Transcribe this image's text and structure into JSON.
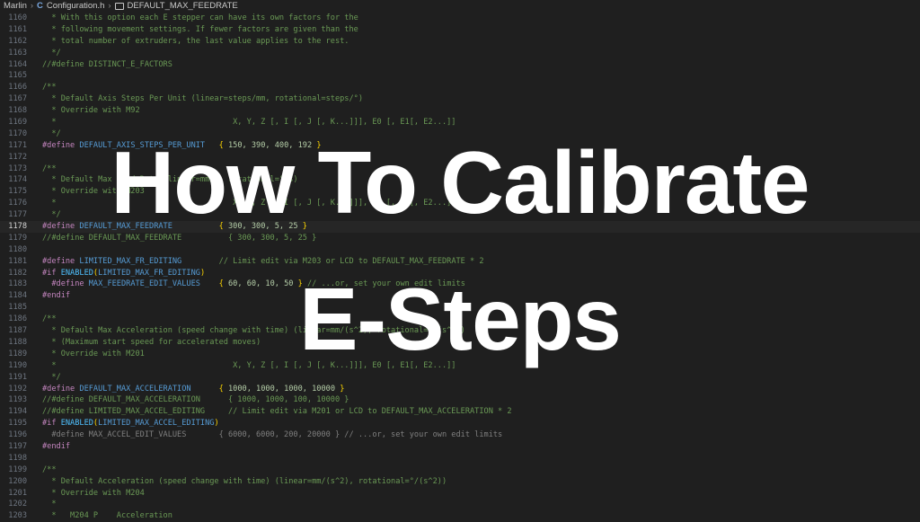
{
  "breadcrumb": {
    "items": [
      "Marlin",
      "Configuration.h",
      "DEFAULT_MAX_FEEDRATE"
    ],
    "file_icon": "c-language-icon",
    "symbol_icon": "symbol-constant-icon"
  },
  "editor": {
    "active_line": "1178",
    "lines": [
      {
        "n": "1160",
        "t": [
          [
            "cm",
            "  * With this option each E stepper can have its own factors for the"
          ]
        ]
      },
      {
        "n": "1161",
        "t": [
          [
            "cm",
            "  * following movement settings. If fewer factors are given than the"
          ]
        ]
      },
      {
        "n": "1162",
        "t": [
          [
            "cm",
            "  * total number of extruders, the last value applies to the rest."
          ]
        ]
      },
      {
        "n": "1163",
        "t": [
          [
            "cm",
            "  */"
          ]
        ]
      },
      {
        "n": "1164",
        "t": [
          [
            "cm",
            "//#define DISTINCT_E_FACTORS"
          ]
        ]
      },
      {
        "n": "1165",
        "t": []
      },
      {
        "n": "1166",
        "t": [
          [
            "cm",
            "/**"
          ]
        ]
      },
      {
        "n": "1167",
        "t": [
          [
            "cm",
            "  * Default Axis Steps Per Unit (linear=steps/mm, rotational=steps/°)"
          ]
        ]
      },
      {
        "n": "1168",
        "t": [
          [
            "cm",
            "  * Override with M92"
          ]
        ]
      },
      {
        "n": "1169",
        "t": [
          [
            "cm",
            "  *                                      X, Y, Z [, I [, J [, K...]]], E0 [, E1[, E2...]]"
          ]
        ]
      },
      {
        "n": "1170",
        "t": [
          [
            "cm",
            "  */"
          ]
        ]
      },
      {
        "n": "1171",
        "t": [
          [
            "kw",
            "#define "
          ],
          [
            "mac",
            "DEFAULT_AXIS_STEPS_PER_UNIT"
          ],
          [
            "",
            "   "
          ],
          [
            "br",
            "{"
          ],
          [
            "num",
            " 150, 390, 400, 192 "
          ],
          [
            "br",
            "}"
          ]
        ]
      },
      {
        "n": "1172",
        "t": []
      },
      {
        "n": "1173",
        "t": [
          [
            "cm",
            "/**"
          ]
        ]
      },
      {
        "n": "1174",
        "t": [
          [
            "cm",
            "  * Default Max Feed Rate (linear=mm/s, rotational=°/s)"
          ]
        ]
      },
      {
        "n": "1175",
        "t": [
          [
            "cm",
            "  * Override with M203"
          ]
        ]
      },
      {
        "n": "1176",
        "t": [
          [
            "cm",
            "  *                                      X, Y, Z [, I [, J [, K...]]], E0 [, E1[, E2...]]"
          ]
        ]
      },
      {
        "n": "1177",
        "t": [
          [
            "cm",
            "  */"
          ]
        ]
      },
      {
        "n": "1178",
        "t": [
          [
            "kw",
            "#define "
          ],
          [
            "mac",
            "DEFAULT_MAX_FEEDRATE"
          ],
          [
            "",
            "          "
          ],
          [
            "br",
            "{"
          ],
          [
            "num",
            " 300, 300, 5, 25 "
          ],
          [
            "br",
            "}"
          ]
        ]
      },
      {
        "n": "1179",
        "t": [
          [
            "cm",
            "//#define DEFAULT_MAX_FEEDRATE          { 300, 300, 5, 25 }"
          ]
        ]
      },
      {
        "n": "1180",
        "t": []
      },
      {
        "n": "1181",
        "t": [
          [
            "kw",
            "#define "
          ],
          [
            "mac",
            "LIMITED_MAX_FR_EDITING"
          ],
          [
            "",
            "        "
          ],
          [
            "cm",
            "// Limit edit via M203 or LCD to DEFAULT_MAX_FEEDRATE * 2"
          ]
        ]
      },
      {
        "n": "1182",
        "t": [
          [
            "kw",
            "#if "
          ],
          [
            "fn",
            "ENABLED"
          ],
          [
            "br",
            "("
          ],
          [
            "mac",
            "LIMITED_MAX_FR_EDITING"
          ],
          [
            "br",
            ")"
          ]
        ]
      },
      {
        "n": "1183",
        "t": [
          [
            "kw",
            "  #define "
          ],
          [
            "mac",
            "MAX_FEEDRATE_EDIT_VALUES"
          ],
          [
            "",
            "    "
          ],
          [
            "br",
            "{"
          ],
          [
            "num",
            " 60, 60, 10, 50 "
          ],
          [
            "br",
            "}"
          ],
          [
            "cm",
            " // ...or, set your own edit limits"
          ]
        ]
      },
      {
        "n": "1184",
        "t": [
          [
            "kw",
            "#endif"
          ]
        ]
      },
      {
        "n": "1185",
        "t": []
      },
      {
        "n": "1186",
        "t": [
          [
            "cm",
            "/**"
          ]
        ]
      },
      {
        "n": "1187",
        "t": [
          [
            "cm",
            "  * Default Max Acceleration (speed change with time) (linear=mm/(s^2), rotational=°/(s^2))"
          ]
        ]
      },
      {
        "n": "1188",
        "t": [
          [
            "cm",
            "  * (Maximum start speed for accelerated moves)"
          ]
        ]
      },
      {
        "n": "1189",
        "t": [
          [
            "cm",
            "  * Override with M201"
          ]
        ]
      },
      {
        "n": "1190",
        "t": [
          [
            "cm",
            "  *                                      X, Y, Z [, I [, J [, K...]]], E0 [, E1[, E2...]]"
          ]
        ]
      },
      {
        "n": "1191",
        "t": [
          [
            "cm",
            "  */"
          ]
        ]
      },
      {
        "n": "1192",
        "t": [
          [
            "kw",
            "#define "
          ],
          [
            "mac",
            "DEFAULT_MAX_ACCELERATION"
          ],
          [
            "",
            "      "
          ],
          [
            "br",
            "{"
          ],
          [
            "num",
            " 1000, 1000, 1000, 10000 "
          ],
          [
            "br",
            "}"
          ]
        ]
      },
      {
        "n": "1193",
        "t": [
          [
            "cm",
            "//#define DEFAULT_MAX_ACCELERATION      { 1000, 1000, 100, 10000 }"
          ]
        ]
      },
      {
        "n": "1194",
        "t": [
          [
            "cm",
            "//#define LIMITED_MAX_ACCEL_EDITING     // Limit edit via M201 or LCD to DEFAULT_MAX_ACCELERATION * 2"
          ]
        ]
      },
      {
        "n": "1195",
        "t": [
          [
            "kw",
            "#if "
          ],
          [
            "fn",
            "ENABLED"
          ],
          [
            "br",
            "("
          ],
          [
            "mac",
            "LIMITED_MAX_ACCEL_EDITING"
          ],
          [
            "br",
            ")"
          ]
        ]
      },
      {
        "n": "1196",
        "t": [
          [
            "dim",
            "  #define MAX_ACCEL_EDIT_VALUES       { 6000, 6000, 200, 20000 } // ...or, set your own edit limits"
          ]
        ]
      },
      {
        "n": "1197",
        "t": [
          [
            "kw",
            "#endif"
          ]
        ]
      },
      {
        "n": "1198",
        "t": []
      },
      {
        "n": "1199",
        "t": [
          [
            "cm",
            "/**"
          ]
        ]
      },
      {
        "n": "1200",
        "t": [
          [
            "cm",
            "  * Default Acceleration (speed change with time) (linear=mm/(s^2), rotational=°/(s^2))"
          ]
        ]
      },
      {
        "n": "1201",
        "t": [
          [
            "cm",
            "  * Override with M204"
          ]
        ]
      },
      {
        "n": "1202",
        "t": [
          [
            "cm",
            "  *"
          ]
        ]
      },
      {
        "n": "1203",
        "t": [
          [
            "cm",
            "  *   M204 P    Acceleration"
          ]
        ]
      }
    ]
  },
  "overlay": {
    "title_line1": "How To Calibrate",
    "title_line2": "E-Steps"
  },
  "colors": {
    "background": "#1f1f1f",
    "comment": "#6a9955",
    "keyword": "#c586c0",
    "macro": "#569cd6",
    "number": "#b5cea8",
    "bracket": "#ffd700",
    "title": "#ffffff"
  }
}
